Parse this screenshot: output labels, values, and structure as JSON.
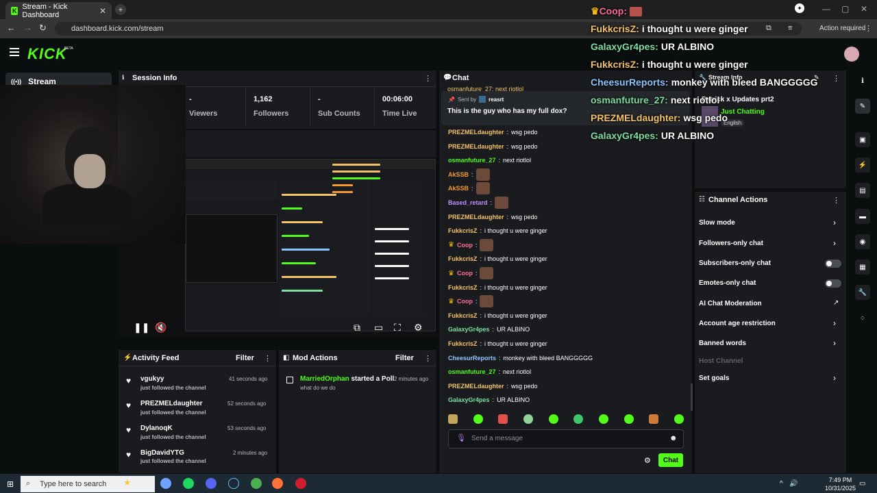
{
  "browser": {
    "tab_title": "Stream - Kick Dashboard",
    "url": "dashboard.kick.com/stream",
    "action_required": "Action required"
  },
  "kick": {
    "logo": "KICK",
    "beta": "BETA"
  },
  "sidebar": {
    "stream_label": "Stream"
  },
  "session_info": {
    "title": "Session Info",
    "stats": [
      {
        "value": "-",
        "label": "Viewers"
      },
      {
        "value": "1,162",
        "label": "Followers"
      },
      {
        "value": "-",
        "label": "Sub Counts"
      },
      {
        "value": "00:06:00",
        "label": "Time Live"
      }
    ]
  },
  "activity_feed": {
    "title": "Activity Feed",
    "filter": "Filter",
    "items": [
      {
        "name": "vgukyy",
        "sub": "just followed the channel",
        "time": "41 seconds ago"
      },
      {
        "name": "PREZMELdaughter",
        "sub": "just followed the channel",
        "time": "52 seconds ago"
      },
      {
        "name": "DylanoqK",
        "sub": "just followed the channel",
        "time": "53 seconds ago"
      },
      {
        "name": "BigDavidYTG",
        "sub": "just followed the channel",
        "time": "2 minutes ago"
      }
    ]
  },
  "mod_actions": {
    "title": "Mod Actions",
    "filter": "Filter",
    "item": {
      "user": "MarriedOrphan",
      "action": "started a Poll",
      "time": "2 minutes ago",
      "detail": "what do we do"
    }
  },
  "chat": {
    "title": "Chat",
    "top_partial": "osmanfuture_27: next riotlol",
    "pinned": {
      "sent_by": "Sent by",
      "sender": "reasrt",
      "message": "This is the guy who has my full dox?"
    },
    "messages": [
      {
        "user": "PREZMELdaughter",
        "text": "wsg pedo",
        "color": "#f5c36b",
        "emote": false,
        "crown": false
      },
      {
        "user": "PREZMELdaughter",
        "text": "wsg pedo",
        "color": "#f5c36b",
        "emote": false,
        "crown": false
      },
      {
        "user": "osmanfuture_27",
        "text": "next riotlol",
        "color": "#53fc18",
        "emote": false,
        "crown": false
      },
      {
        "user": "AkSSB",
        "text": "",
        "color": "#f59b2e",
        "emote": true,
        "crown": false
      },
      {
        "user": "AkSSB",
        "text": "",
        "color": "#f59b2e",
        "emote": true,
        "crown": false
      },
      {
        "user": "Based_retard",
        "text": "",
        "color": "#c38cff",
        "emote": true,
        "crown": false
      },
      {
        "user": "PREZMELdaughter",
        "text": "wsg pedo",
        "color": "#f5c36b",
        "emote": false,
        "crown": false
      },
      {
        "user": "FukkcrisZ",
        "text": "i thought u were ginger",
        "color": "#f5c36b",
        "emote": false,
        "crown": false
      },
      {
        "user": "Coop",
        "text": "",
        "color": "#ff6b9a",
        "emote": true,
        "crown": true
      },
      {
        "user": "FukkcrisZ",
        "text": "i thought u were ginger",
        "color": "#f5c36b",
        "emote": false,
        "crown": false
      },
      {
        "user": "Coop",
        "text": "",
        "color": "#ff6b9a",
        "emote": true,
        "crown": true
      },
      {
        "user": "FukkcrisZ",
        "text": "i thought u were ginger",
        "color": "#f5c36b",
        "emote": false,
        "crown": false
      },
      {
        "user": "Coop",
        "text": "",
        "color": "#ff6b9a",
        "emote": true,
        "crown": true
      },
      {
        "user": "FukkcrisZ",
        "text": "i thought u were ginger",
        "color": "#f5c36b",
        "emote": false,
        "crown": false
      },
      {
        "user": "GalaxyGr4pes",
        "text": "UR ALBINO",
        "color": "#7ee0a0",
        "emote": false,
        "crown": false
      },
      {
        "user": "FukkcrisZ",
        "text": "i thought u were ginger",
        "color": "#f5c36b",
        "emote": false,
        "crown": false
      },
      {
        "user": "CheesurReports",
        "text": "monkey with bleed BANGGGGG",
        "color": "#8ec5ff",
        "emote": false,
        "crown": false
      },
      {
        "user": "osmanfuture_27",
        "text": "next riotlol",
        "color": "#53fc18",
        "emote": false,
        "crown": false
      },
      {
        "user": "PREZMELdaughter",
        "text": "wsg pedo",
        "color": "#f5c36b",
        "emote": false,
        "crown": false
      },
      {
        "user": "GalaxyGr4pes",
        "text": "UR ALBINO",
        "color": "#7ee0a0",
        "emote": false,
        "crown": false
      }
    ],
    "input_placeholder": "Send a message",
    "send_label": "Chat"
  },
  "stream_info": {
    "title": "Stream Info",
    "stream_title": "Patrick x Updates prt2",
    "category": "Just Chatting",
    "language": "English"
  },
  "channel_actions": {
    "title": "Channel Actions",
    "items": [
      {
        "label": "Slow mode",
        "control": "chevron"
      },
      {
        "label": "Followers-only chat",
        "control": "chevron"
      },
      {
        "label": "Subscribers-only chat",
        "control": "toggle"
      },
      {
        "label": "Emotes-only chat",
        "control": "toggle"
      },
      {
        "label": "AI Chat Moderation",
        "control": "external"
      },
      {
        "label": "Account age restriction",
        "control": "chevron"
      },
      {
        "label": "Banned words",
        "control": "chevron"
      },
      {
        "label": "Host Channel",
        "control": "none"
      },
      {
        "label": "Set goals",
        "control": "chevron"
      }
    ]
  },
  "overlay_chat": [
    {
      "user": "Coop:",
      "text": "",
      "color": "#ff6b9a",
      "crown": true
    },
    {
      "user": "FukkcrisZ:",
      "text": "i thought u were ginger",
      "color": "#f5c36b",
      "crown": false
    },
    {
      "user": "GalaxyGr4pes:",
      "text": "UR ALBINO",
      "color": "#7ee0a0",
      "crown": false
    },
    {
      "user": "FukkcrisZ:",
      "text": "i thought u were ginger",
      "color": "#f5c36b",
      "crown": false
    },
    {
      "user": "CheesurReports:",
      "text": "monkey with bleed BANGGGGG",
      "color": "#8ec5ff",
      "crown": false
    },
    {
      "user": "osmanfuture_27:",
      "text": "next riotlol",
      "color": "#7ee0a0",
      "crown": false
    },
    {
      "user": "PREZMELdaughter:",
      "text": "wsg pedo",
      "color": "#f5c36b",
      "crown": false
    },
    {
      "user": "GalaxyGr4pes:",
      "text": "UR ALBINO",
      "color": "#7ee0a0",
      "crown": false
    }
  ],
  "taskbar": {
    "search_placeholder": "Type here to search",
    "time": "7:49 PM",
    "date": "10/31/2025"
  }
}
